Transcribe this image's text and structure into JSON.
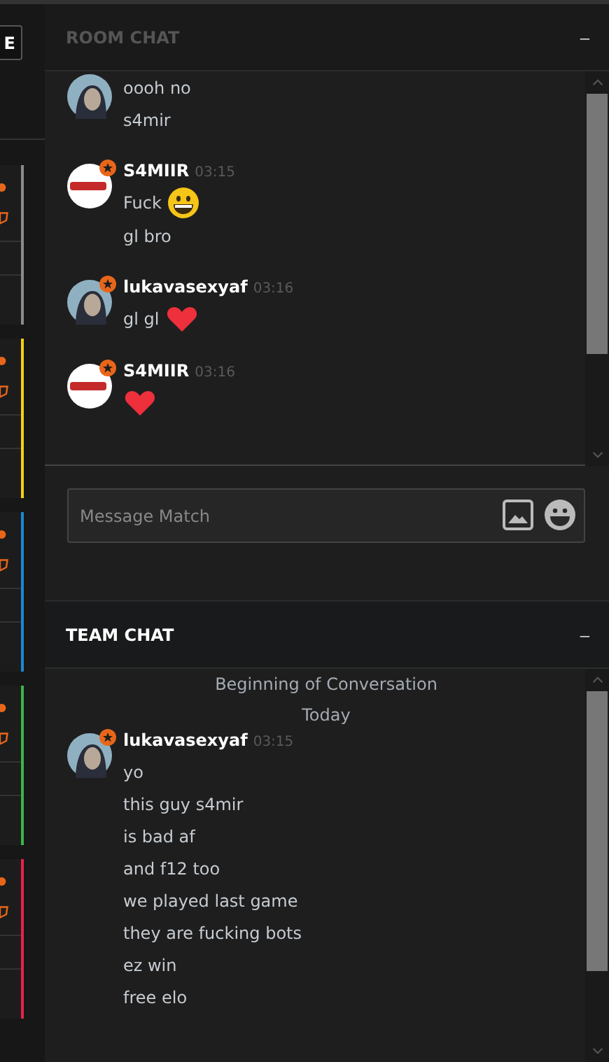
{
  "left_panel": {
    "button": "E",
    "groups": [
      {
        "color": "#8a8a8a"
      },
      {
        "color": "#f2d114"
      },
      {
        "color": "#1f86d3"
      },
      {
        "color": "#3bb54a"
      },
      {
        "color": "#e6234b"
      }
    ]
  },
  "room_chat": {
    "title": "ROOM CHAT",
    "collapse": "–",
    "messages": [
      {
        "avatar": {
          "kind": "figure"
        },
        "lines": [
          {
            "text": "oooh no"
          },
          {
            "text": "s4mir"
          }
        ]
      },
      {
        "author": "S4MIIR",
        "time": "03:15",
        "avatar": {
          "kind": "logo"
        },
        "lines": [
          {
            "text": "Fuck",
            "emoji": {
              "kind": "grin"
            }
          },
          {
            "text": "gl bro"
          }
        ]
      },
      {
        "author": "lukavasexyaf",
        "time": "03:16",
        "avatar": {
          "kind": "figure"
        },
        "lines": [
          {
            "text": "gl gl",
            "emoji": {
              "kind": "heart"
            }
          }
        ]
      },
      {
        "author": "S4MIIR",
        "time": "03:16",
        "avatar": {
          "kind": "logo"
        },
        "lines": [
          {
            "emoji": {
              "kind": "heart"
            }
          }
        ]
      }
    ],
    "input": {
      "placeholder": "Message Match"
    }
  },
  "team_chat": {
    "title": "TEAM CHAT",
    "collapse": "–",
    "notices": [
      "Beginning of Conversation",
      "Today"
    ],
    "messages": [
      {
        "author": "lukavasexyaf",
        "time": "03:15",
        "avatar": {
          "kind": "figure"
        },
        "lines": [
          {
            "text": "yo"
          },
          {
            "text": "this guy s4mir"
          },
          {
            "text": "is bad af"
          },
          {
            "text": "and f12 too"
          },
          {
            "text": "we played last game"
          },
          {
            "text": "they are fucking bots"
          },
          {
            "text": "ez win"
          },
          {
            "text": "free elo"
          }
        ]
      }
    ]
  }
}
